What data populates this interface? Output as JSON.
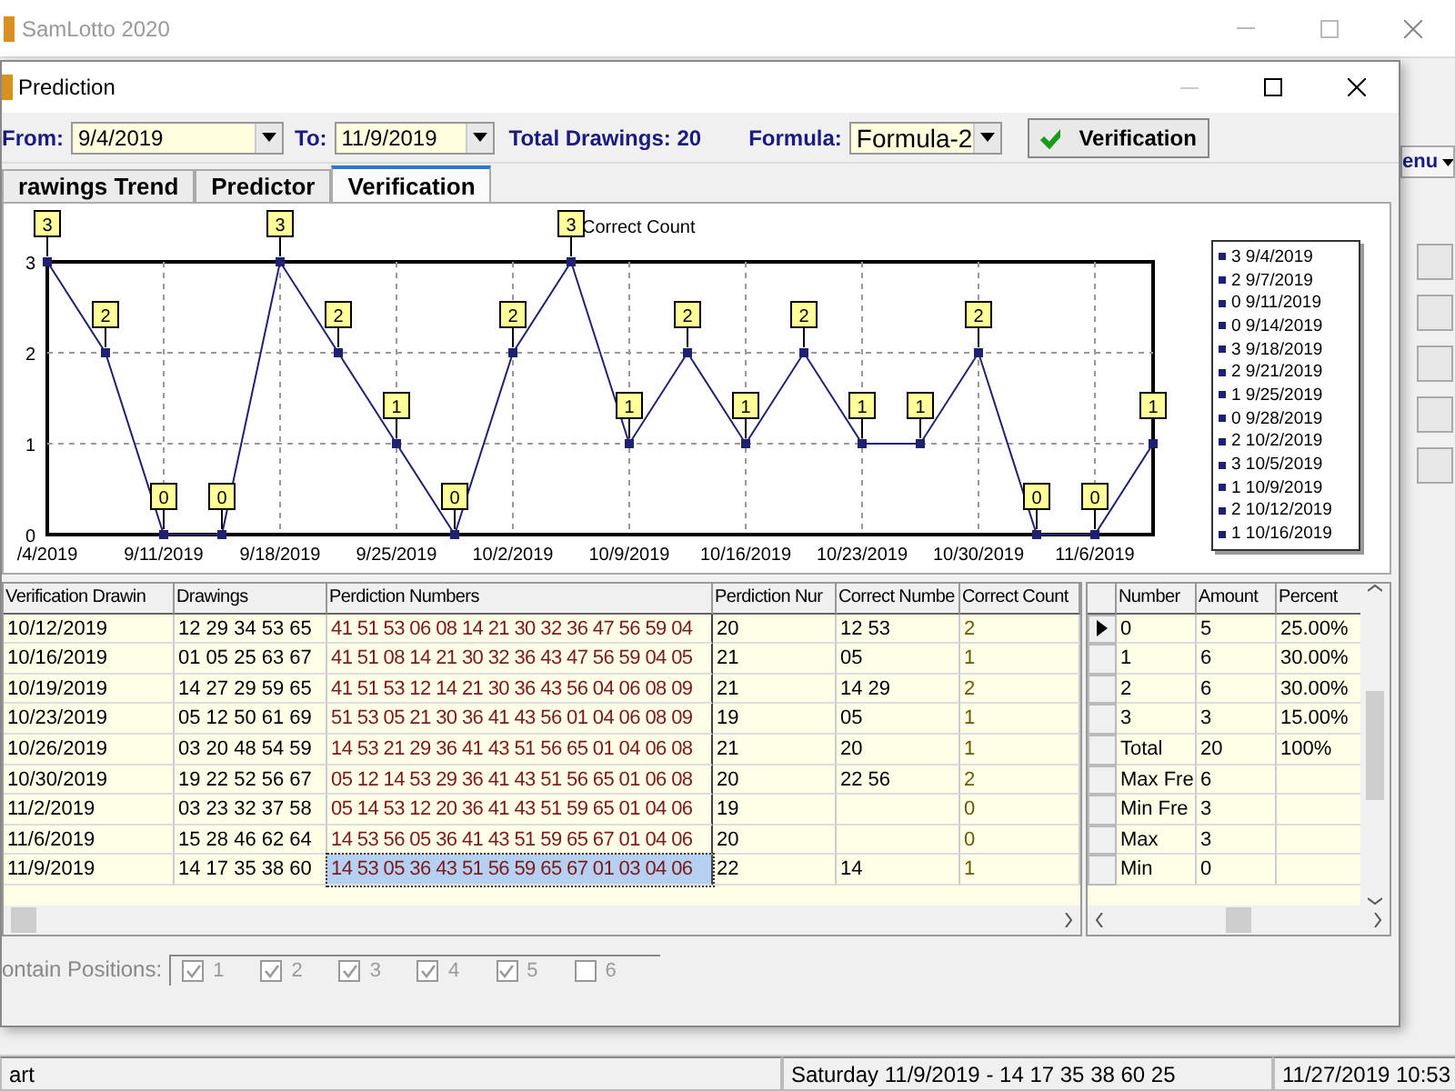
{
  "app": {
    "title": "SamLotto 2020",
    "menu_button": "enu"
  },
  "dialog": {
    "title": "Prediction",
    "toolbar": {
      "from_label": "From:",
      "from_value": "9/4/2019",
      "to_label": "To:",
      "to_value": "11/9/2019",
      "total": "Total Drawings: 20",
      "formula_label": "Formula:",
      "formula_value": "Formula-2",
      "button": "Verification"
    },
    "tabs": [
      {
        "label": "rawings Trend",
        "selected": false
      },
      {
        "label": "Predictor",
        "selected": false
      },
      {
        "label": "Verification",
        "selected": true
      }
    ],
    "chart": {
      "chart_data": {
        "type": "line",
        "title": "Correct Count",
        "categories": [
          "/4/2019",
          null,
          "9/11/2019",
          null,
          "9/18/2019",
          null,
          "9/25/2019",
          null,
          "10/2/2019",
          null,
          "10/9/2019",
          null,
          "10/16/2019",
          null,
          "10/23/2019",
          null,
          "10/30/2019",
          null,
          "11/6/2019",
          null
        ],
        "series": [
          {
            "color": "#202070",
            "marker": "square",
            "values": [
              3,
              2,
              0,
              0,
              3,
              2,
              1,
              0,
              2,
              3,
              1,
              2,
              1,
              2,
              1,
              1,
              2,
              0,
              0,
              1
            ]
          }
        ],
        "ylim": [
          0,
          3
        ],
        "yticks": [
          0,
          1,
          2,
          3
        ],
        "grid": true,
        "data_labels": true
      },
      "legend": [
        "3 9/4/2019",
        "2 9/7/2019",
        "0 9/11/2019",
        "0 9/14/2019",
        "3 9/18/2019",
        "2 9/21/2019",
        "1 9/25/2019",
        "0 9/28/2019",
        "2 10/2/2019",
        "3 10/5/2019",
        "1 10/9/2019",
        "2 10/12/2019",
        "1 10/16/2019"
      ]
    },
    "verification_table": {
      "columns": [
        "Verification Drawin",
        "Drawings",
        "Perdiction Numbers",
        "Perdiction Nur",
        "Correct Numbe",
        "Correct Count"
      ],
      "rows": [
        {
          "drawing_date": "10/12/2019",
          "drawings": "12 29 34 53 65",
          "prediction_numbers": "41 51 53 06 08 14 21 30 32 36 47 56 59 04",
          "prediction_count": "20",
          "correct_numbers": "12 53",
          "correct_count": "2",
          "selected": false
        },
        {
          "drawing_date": "10/16/2019",
          "drawings": "01 05 25 63 67",
          "prediction_numbers": "41 51 08 14 21 30 32 36 43 47 56 59 04 05",
          "prediction_count": "21",
          "correct_numbers": "05",
          "correct_count": "1",
          "selected": false
        },
        {
          "drawing_date": "10/19/2019",
          "drawings": "14 27 29 59 65",
          "prediction_numbers": "41 51 53 12 14 21 30 36 43 56 04 06 08 09",
          "prediction_count": "21",
          "correct_numbers": "14 29",
          "correct_count": "2",
          "selected": false
        },
        {
          "drawing_date": "10/23/2019",
          "drawings": "05 12 50 61 69",
          "prediction_numbers": "51 53 05 21 30 36 41 43 56 01 04 06 08 09",
          "prediction_count": "19",
          "correct_numbers": "05",
          "correct_count": "1",
          "selected": false
        },
        {
          "drawing_date": "10/26/2019",
          "drawings": "03 20 48 54 59",
          "prediction_numbers": "14 53 21 29 36 41 43 51 56 65 01 04 06 08",
          "prediction_count": "21",
          "correct_numbers": "20",
          "correct_count": "1",
          "selected": false
        },
        {
          "drawing_date": "10/30/2019",
          "drawings": "19 22 52 56 67",
          "prediction_numbers": "05 12 14 53 29 36 41 43 51 56 65 01 06 08",
          "prediction_count": "20",
          "correct_numbers": "22 56",
          "correct_count": "2",
          "selected": false
        },
        {
          "drawing_date": "11/2/2019",
          "drawings": "03 23 32 37 58",
          "prediction_numbers": "05 14 53 12 20 36 41 43 51 59 65 01 04 06",
          "prediction_count": "19",
          "correct_count": "0",
          "selected": false
        },
        {
          "drawing_date": "11/6/2019",
          "drawings": "15 28 46 62 64",
          "prediction_numbers": "14 53 56 05 36 41 43 51 59 65 67 01 04 06",
          "prediction_count": "20",
          "correct_count": "0",
          "selected": false
        },
        {
          "drawing_date": "11/9/2019",
          "drawings": "14 17 35 38 60",
          "prediction_numbers": "14 53 05 36 43 51 56 59 65 67 01 03 04 06",
          "prediction_count": "22",
          "correct_numbers": "14",
          "correct_count": "1",
          "selected": true
        }
      ]
    },
    "summary_table": {
      "columns": [
        "Number",
        "Amount",
        "Percent"
      ],
      "rows": [
        {
          "number": "0",
          "amount": "5",
          "percent": "25.00%",
          "selected": true
        },
        {
          "number": "1",
          "amount": "6",
          "percent": "30.00%",
          "selected": false
        },
        {
          "number": "2",
          "amount": "6",
          "percent": "30.00%",
          "selected": false
        },
        {
          "number": "3",
          "amount": "3",
          "percent": "15.00%",
          "selected": false
        },
        {
          "number": "Total",
          "amount": "20",
          "percent": "100%",
          "selected": false
        },
        {
          "number": "Max Fre",
          "amount": "6",
          "selected": false
        },
        {
          "number": "Min Fre",
          "amount": "3",
          "selected": false
        },
        {
          "number": "Max",
          "amount": "3",
          "selected": false
        },
        {
          "number": "Min",
          "amount": "0",
          "selected": false
        }
      ]
    },
    "positions": {
      "label": "ontain Positions:",
      "disabled": true,
      "items": [
        {
          "label": "1",
          "checked": true
        },
        {
          "label": "2",
          "checked": true
        },
        {
          "label": "3",
          "checked": true
        },
        {
          "label": "4",
          "checked": true
        },
        {
          "label": "5",
          "checked": true
        },
        {
          "label": "6",
          "checked": false
        }
      ]
    }
  },
  "status_bar": [
    "art",
    "Saturday 11/9/2019 - 14 17 35 38 60 25",
    "11/27/2019 10:53"
  ]
}
